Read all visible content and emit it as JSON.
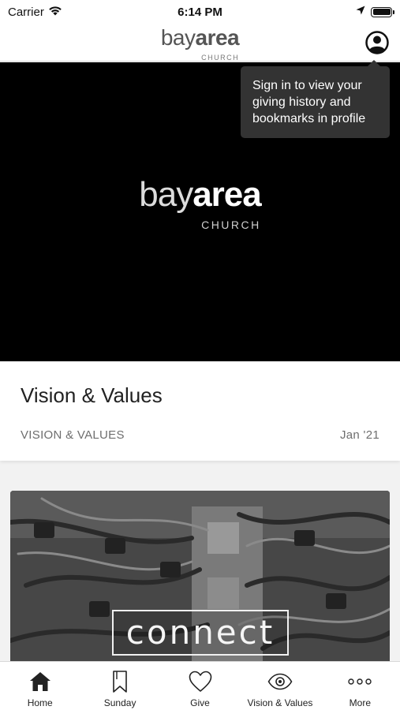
{
  "status_bar": {
    "carrier": "Carrier",
    "time": "6:14 PM",
    "battery_level": 1.0
  },
  "header": {
    "brand_light": "bay",
    "brand_bold": "area",
    "brand_sub": "CHURCH",
    "profile_icon": "user-profile-icon"
  },
  "tooltip": {
    "text": "Sign in to view your giving history and bookmarks in profile"
  },
  "hero": {
    "logo_light": "bay",
    "logo_bold": "area",
    "logo_sub": "CHURCH"
  },
  "info_card": {
    "title": "Vision & Values",
    "category": "VISION & VALUES",
    "date": "Jan '21"
  },
  "connect_card": {
    "label": "connect"
  },
  "tab_bar": {
    "tabs": [
      {
        "label": "Home",
        "icon": "home-icon"
      },
      {
        "label": "Sunday",
        "icon": "bookmark-icon"
      },
      {
        "label": "Give",
        "icon": "heart-icon"
      },
      {
        "label": "Vision & Values",
        "icon": "eye-icon"
      },
      {
        "label": "More",
        "icon": "more-icon"
      }
    ]
  },
  "colors": {
    "hero_background": "#000000",
    "tooltip_background": "#333333",
    "text_muted": "#6e6e6e"
  }
}
